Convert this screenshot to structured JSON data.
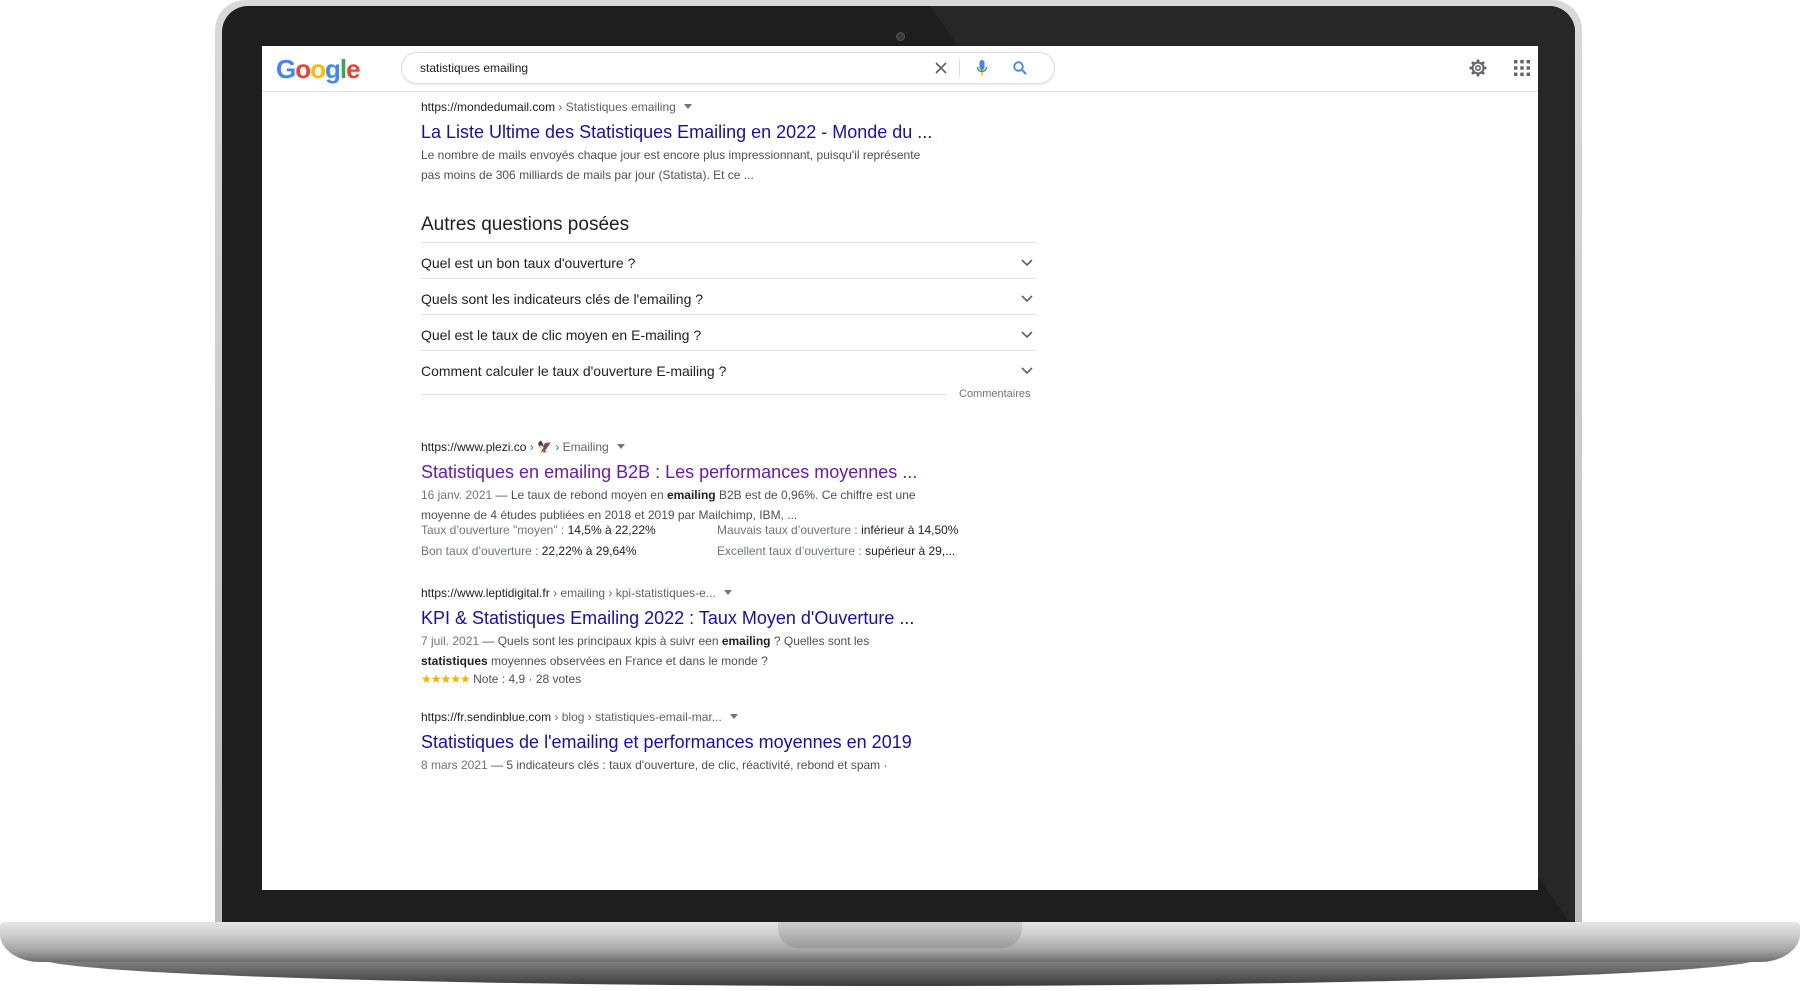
{
  "search": {
    "query": "statistiques emailing"
  },
  "logo": {
    "letters": [
      "G",
      "o",
      "o",
      "g",
      "l",
      "e"
    ]
  },
  "results": [
    {
      "url": "https://mondedumail.com",
      "crumbs": "› Statistiques emailing",
      "title": "La Liste Ultime des Statistiques Emailing en 2022 - Monde du ...",
      "snippet_1": "Le nombre de mails envoyés chaque jour est encore plus impressionnant, puisqu'il représente",
      "snippet_2": "pas moins de 306 milliards de mails par jour (Statista). Et ce ..."
    },
    {
      "url": "https://www.plezi.co",
      "crumbs": "› 🦅 › Emailing",
      "title": "Statistiques en emailing B2B : Les performances moyennes ...",
      "date": "16 janv. 2021",
      "snippet_a": " — Le taux de rebond moyen en ",
      "snippet_b": "emailing",
      "snippet_c": " B2B est de 0,96%. Ce chiffre est une",
      "snippet_2": "moyenne de 4 études publiées en 2018 et 2019 par Mailchimp, IBM, ...",
      "attributes": [
        {
          "k": "Taux d’ouverture \"moyen\" : ",
          "v": "14,5% à 22,22%"
        },
        {
          "k": "Mauvais taux d’ouverture : ",
          "v": "inférieur à 14,50%"
        },
        {
          "k": "Bon taux d’ouverture : ",
          "v": "22,22% à 29,64%"
        },
        {
          "k": "Excellent taux d’ouverture : ",
          "v": "supérieur à 29,..."
        }
      ]
    },
    {
      "url": "https://www.leptidigital.fr",
      "crumbs": "› emailing › kpi-statistiques-e...",
      "title": "KPI & Statistiques Emailing 2022 : Taux Moyen d'Ouverture ...",
      "date": "7 juil. 2021",
      "snippet_a": " — Quels sont les principaux kpis à suivr een ",
      "snippet_b": "emailing",
      "snippet_c": " ? Quelles sont les",
      "snippet_2b": "statistiques",
      "snippet_2c": " moyennes observées en France et dans le monde ?",
      "rating_stars": "★★★★★",
      "rating_text": " Note : 4,9 · 28 votes"
    },
    {
      "url": "https://fr.sendinblue.com",
      "crumbs": "› blog › statistiques-email-mar...",
      "title": "Statistiques de l'emailing et performances moyennes en 2019",
      "date": "8 mars 2021",
      "snippet_a": " — 5 indicateurs clés : taux d'ouverture, de clic, réactivité, rebond et spam ·"
    }
  ],
  "paa": {
    "heading": "Autres questions posées",
    "questions": [
      "Quel est un bon taux d'ouverture ?",
      "Quels sont les indicateurs clés de l'emailing ?",
      "Quel est le taux de clic moyen en E-mailing ?",
      "Comment calculer le taux d'ouverture E-mailing ?"
    ],
    "feedback": "Commentaires"
  },
  "icons": [
    "clear-icon",
    "microphone-icon",
    "search-icon",
    "settings-gear-icon",
    "apps-grid-icon",
    "chevron-down-icon"
  ],
  "colors": {
    "link": "#1a0dab",
    "visited": "#681da8",
    "google_blue": "#4285f4",
    "google_red": "#ea4335",
    "google_yellow": "#fbbc05",
    "google_green": "#34a853"
  }
}
